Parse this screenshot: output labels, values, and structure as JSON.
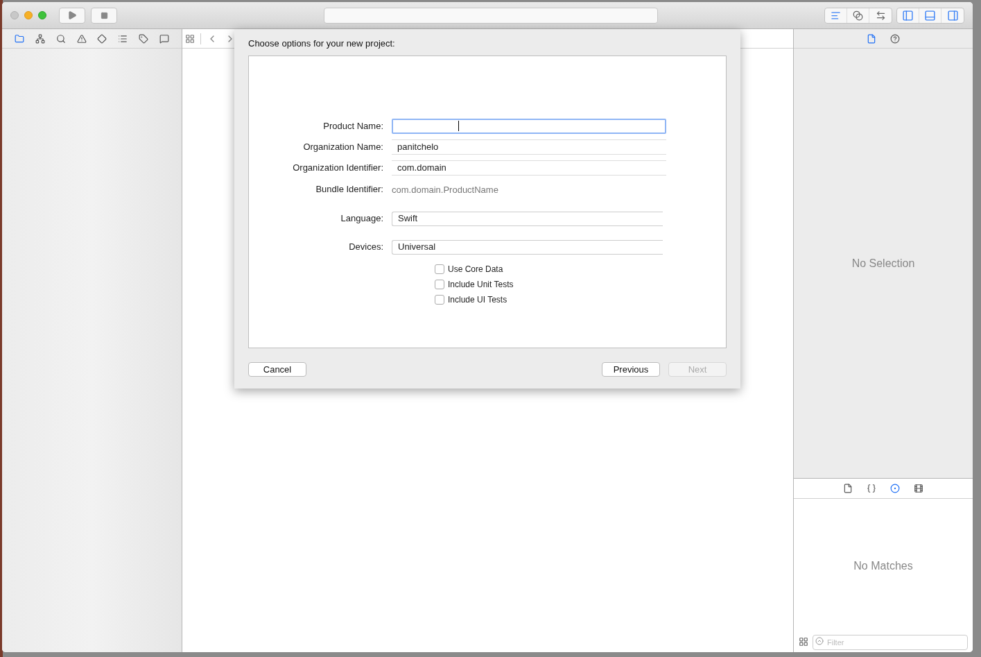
{
  "toolbar": {
    "run_enabled": true,
    "editor_modes": [
      {
        "selected": true
      },
      {
        "selected": false
      },
      {
        "selected": false
      }
    ],
    "panels": [
      {
        "on": true
      },
      {
        "on": true
      },
      {
        "on": true
      }
    ]
  },
  "navigator_tabs": [
    {
      "selected": true
    },
    {
      "selected": false
    },
    {
      "selected": false
    },
    {
      "selected": false
    },
    {
      "selected": false
    },
    {
      "selected": false
    },
    {
      "selected": false
    },
    {
      "selected": false
    }
  ],
  "dialog": {
    "title": "Choose options for your new project:",
    "fields": [
      {
        "kind": "text",
        "label": "Product Name:",
        "focused": true
      },
      {
        "kind": "text",
        "label": "Organization Name:",
        "value": "panitchelo",
        "focused": false
      },
      {
        "kind": "text",
        "label": "Organization Identifier:",
        "value": "com.domain",
        "focused": false
      },
      {
        "kind": "static",
        "label": "Bundle Identifier:",
        "value": "com.domain.ProductName"
      },
      {
        "kind": "select",
        "label": "Language:",
        "value": "Swift"
      },
      {
        "kind": "select",
        "label": "Devices:",
        "value": "Universal"
      }
    ],
    "checkboxes": [
      {
        "label": "Use Core Data",
        "checked": false
      },
      {
        "label": "Include Unit Tests",
        "checked": false
      },
      {
        "label": "Include UI Tests",
        "checked": false
      }
    ],
    "buttons": [
      {
        "label": "Cancel",
        "disabled": false
      },
      {
        "label": "Previous",
        "disabled": false
      },
      {
        "label": "Next",
        "disabled": true
      }
    ]
  },
  "inspector": {
    "tabs": [
      {
        "selected": true
      },
      {
        "selected": false
      }
    ],
    "message": "No Selection"
  },
  "library": {
    "tabs": [
      {
        "selected": false
      },
      {
        "selected": false
      },
      {
        "selected": true
      },
      {
        "selected": false
      }
    ],
    "message": "No Matches",
    "filter": {
      "placeholder": "Filter"
    }
  }
}
